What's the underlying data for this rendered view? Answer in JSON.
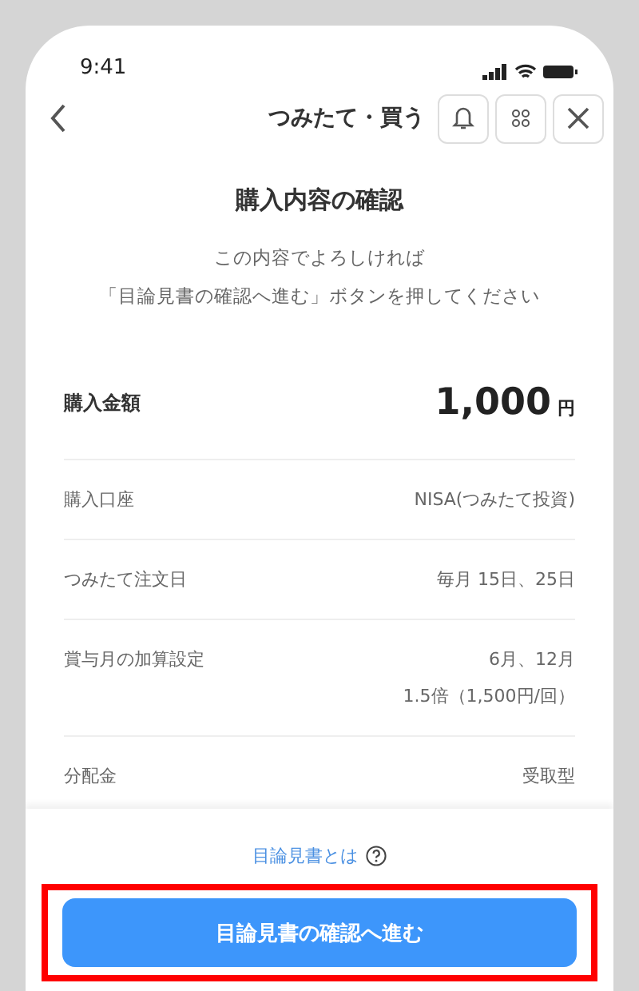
{
  "status_bar": {
    "time": "9:41"
  },
  "header": {
    "title": "つみたて・買う"
  },
  "heading": "購入内容の確認",
  "instructions": [
    "この内容でよろしければ",
    "「目論見書の確認へ進む」ボタンを押してください"
  ],
  "amount": {
    "label": "購入金額",
    "value": "1,000",
    "unit": "円"
  },
  "rows": [
    {
      "label": "購入口座",
      "values": [
        "NISA(つみたて投資)"
      ]
    },
    {
      "label": "つみたて注文日",
      "values": [
        "毎月 15日、25日"
      ]
    },
    {
      "label": "賞与月の加算設定",
      "values": [
        "6月、12月",
        "1.5倍（1,500円/回）"
      ]
    },
    {
      "label": "分配金",
      "values": [
        "受取型"
      ]
    }
  ],
  "footer": {
    "link": "目論見書とは",
    "button": {
      "label": "目論見書の確認へ進む",
      "highlighted": true
    }
  }
}
